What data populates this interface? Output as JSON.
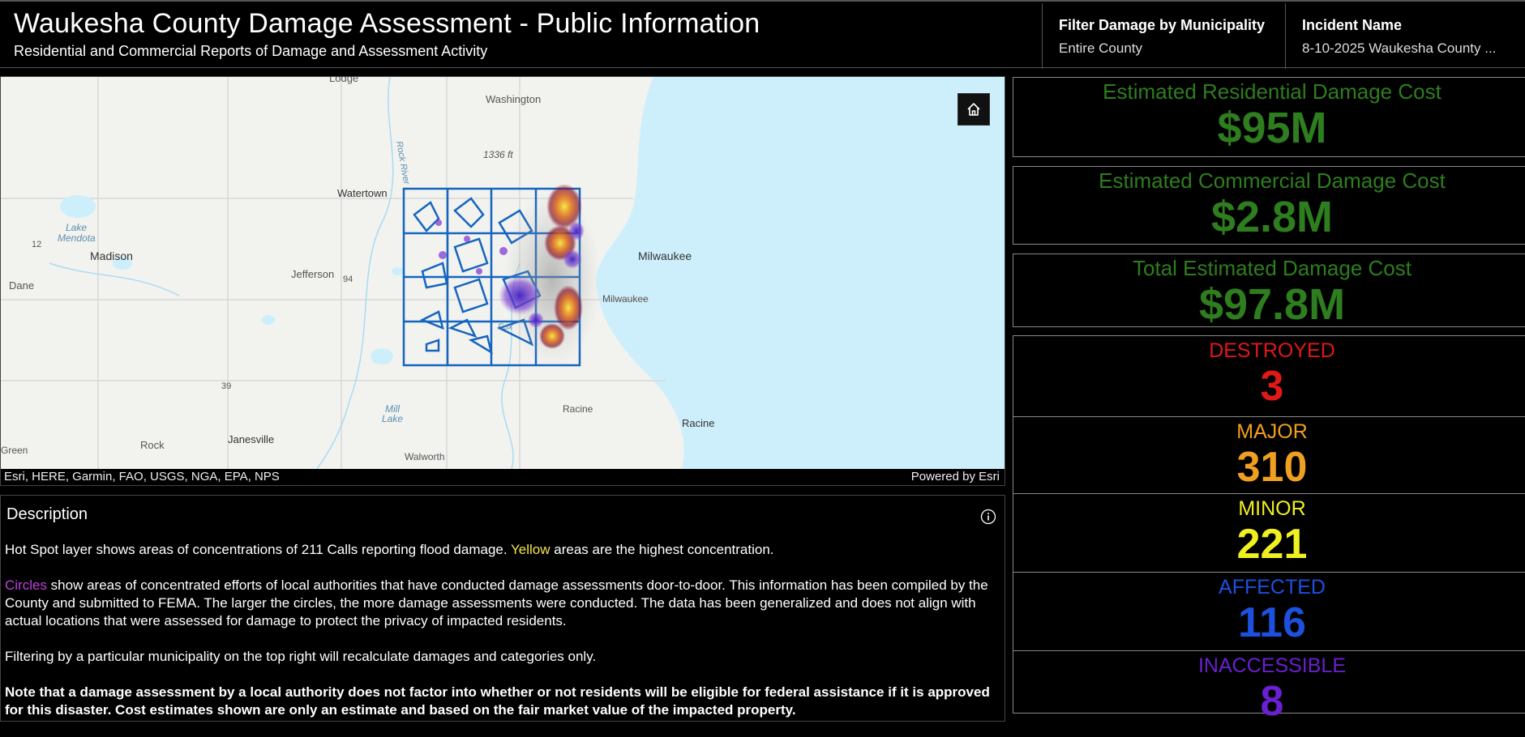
{
  "header": {
    "title": "Waukesha County Damage Assessment - Public Information",
    "subtitle": "Residential and Commercial Reports of Damage and Assessment Activity",
    "filter_label": "Filter Damage by Municipality",
    "filter_value": "Entire County",
    "incident_label": "Incident Name",
    "incident_value": "8-10-2025 Waukesha County ..."
  },
  "map": {
    "place_labels": {
      "lodge": "Lodge",
      "washington": "Washington",
      "elevation": "1336 ft",
      "watertown": "Watertown",
      "lake_mendota": "Lake\nMendota",
      "madison": "Madison",
      "dane": "Dane",
      "jefferson": "Jefferson",
      "milwaukee_city": "Milwaukee",
      "milwaukee_county": "Milwaukee",
      "racine_county": "Racine",
      "racine_city": "Racine",
      "rock": "Rock",
      "janesville": "Janesville",
      "walworth": "Walworth",
      "green": "Green",
      "mill_lake": "Mill\nLake",
      "rock_river": "Rock River",
      "fox": "Fox",
      "hwy94": "94",
      "hwy12": "12",
      "hwy39": "39"
    },
    "attribution": "Esri, HERE, Garmin, FAO, USGS, NGA, EPA, NPS",
    "powered_by": "Powered by Esri",
    "colors": {
      "boundary": "#1565c0",
      "hotspot_high": "#f5e64a",
      "assessment": "#7b2fd0",
      "water": "#cdeffc",
      "land": "#f2f2ef"
    }
  },
  "description": {
    "title": "Description",
    "p1_a": "Hot Spot layer shows areas of concentrations of 211 Calls reporting flood damage.  ",
    "p1_yellow": "Yellow",
    "p1_b": " areas are the highest concentration.",
    "p2_purple": "Circles",
    "p2_b": " show areas of concentrated efforts of local authorities that have conducted damage assessments door-to-door. This information has been compiled by the County and submitted to FEMA.  The larger the circles, the more damage assessments were conducted.  The data has been generalized and does not align with actual locations that were assessed for damage to protect the privacy of impacted residents.",
    "p3": "Filtering by a particular municipality on the top right will recalculate damages and categories only.",
    "p4": "Note that a damage assessment by a local authority does not factor into whether or not residents will be eligible for federal assistance if it is approved for this disaster.  Cost estimates shown are only an estimate and based on the fair market value of the impacted property."
  },
  "stats": {
    "residential_label": "Estimated Residential Damage Cost",
    "residential_value": "$95M",
    "commercial_label": "Estimated Commercial Damage Cost",
    "commercial_value": "$2.8M",
    "total_label": "Total Estimated Damage Cost",
    "total_value": "$97.8M",
    "categories": [
      {
        "label": "DESTROYED",
        "value": "3",
        "color": "#e01818"
      },
      {
        "label": "MAJOR",
        "value": "310",
        "color": "#f0a020"
      },
      {
        "label": "MINOR",
        "value": "221",
        "color": "#f0f020"
      },
      {
        "label": "AFFECTED",
        "value": "116",
        "color": "#1e50e0"
      },
      {
        "label": "INACCESSIBLE",
        "value": "8",
        "color": "#6a1fd0"
      }
    ]
  }
}
